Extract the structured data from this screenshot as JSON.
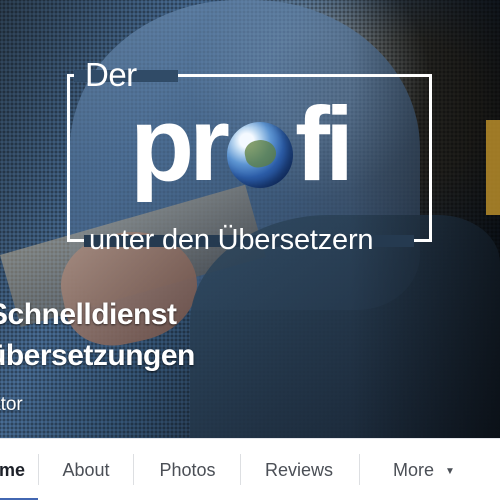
{
  "cover": {
    "logo": {
      "top_text": "Der",
      "main_prefix": "pr",
      "main_suffix": "fi",
      "bottom_text": "unter den Übersetzern"
    },
    "page_name_lines": [
      "Schnelldienst",
      "übersetzungen"
    ],
    "category": "ator"
  },
  "tabs": {
    "home": "me",
    "about": "About",
    "photos": "Photos",
    "reviews": "Reviews",
    "more": "More",
    "more_icon": "▼"
  },
  "colors": {
    "accent": "#4267b2",
    "tab_text": "#4b4f56",
    "active_tab_text": "#1d2129",
    "logo": "#ffffff"
  },
  "icons": {
    "globe": "globe-icon",
    "more": "dropdown-caret-icon"
  }
}
